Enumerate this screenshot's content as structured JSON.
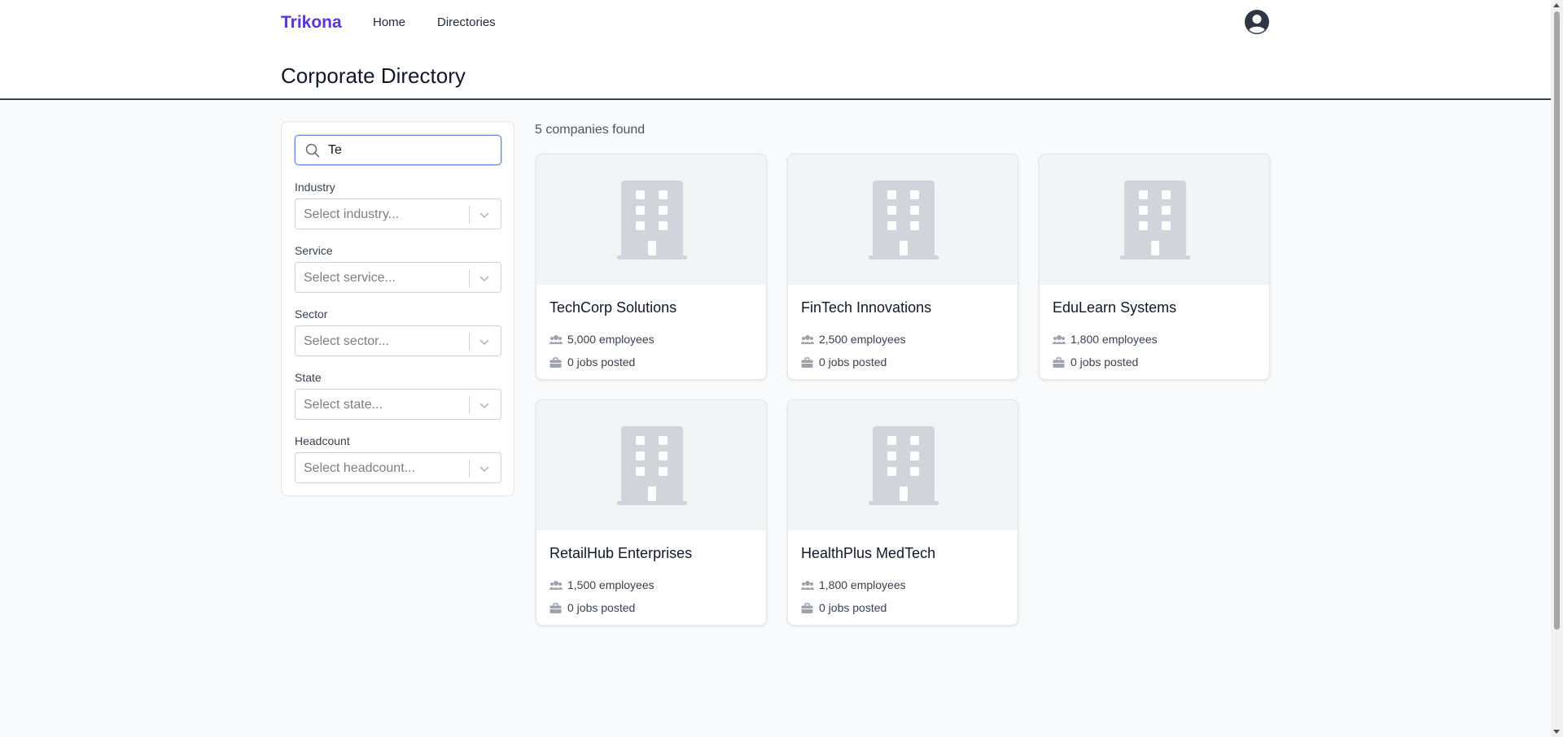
{
  "nav": {
    "brand": "Trikona",
    "links": [
      "Home",
      "Directories"
    ],
    "accent_color": "#5b35d5"
  },
  "page": {
    "title": "Corporate Directory"
  },
  "filters": {
    "search": {
      "value": "Te",
      "icon": "search-icon"
    },
    "fields": [
      {
        "label": "Industry",
        "placeholder": "Select industry..."
      },
      {
        "label": "Service",
        "placeholder": "Select service..."
      },
      {
        "label": "Sector",
        "placeholder": "Select sector..."
      },
      {
        "label": "State",
        "placeholder": "Select state..."
      },
      {
        "label": "Headcount",
        "placeholder": "Select headcount..."
      }
    ]
  },
  "results": {
    "count_text": "5 companies found",
    "companies": [
      {
        "name": "TechCorp Solutions",
        "employees": "5,000 employees",
        "jobs": "0 jobs posted"
      },
      {
        "name": "FinTech Innovations",
        "employees": "2,500 employees",
        "jobs": "0 jobs posted"
      },
      {
        "name": "EduLearn Systems",
        "employees": "1,800 employees",
        "jobs": "0 jobs posted"
      },
      {
        "name": "RetailHub Enterprises",
        "employees": "1,500 employees",
        "jobs": "0 jobs posted"
      },
      {
        "name": "HealthPlus MedTech",
        "employees": "1,800 employees",
        "jobs": "0 jobs posted"
      }
    ]
  }
}
